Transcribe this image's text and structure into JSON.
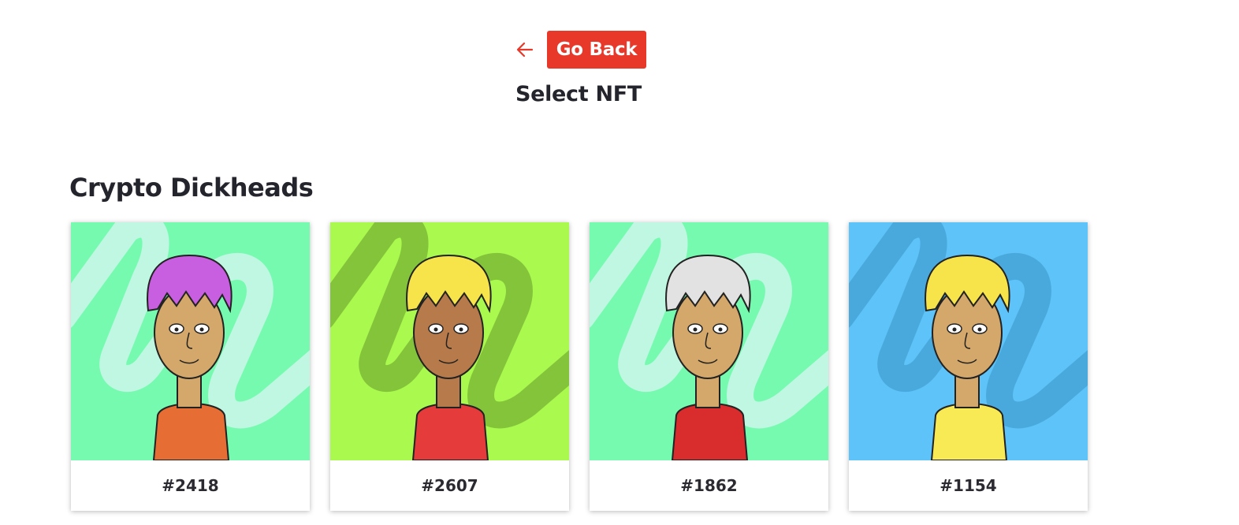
{
  "header": {
    "back_label": "Go Back",
    "page_title": "Select NFT",
    "accent_color": "#e8382a"
  },
  "collection": {
    "title": "Crypto Dickheads",
    "items": [
      {
        "token": "#2418",
        "bg": "#76fab0",
        "swirl": "#bff7e2",
        "hair": "#c75fe0",
        "skin": "#d4a76a",
        "shirt": "#e66d33"
      },
      {
        "token": "#2607",
        "bg": "#a9f94e",
        "swirl": "#84c43a",
        "hair": "#f7e44a",
        "skin": "#b77a4a",
        "shirt": "#e53b3b"
      },
      {
        "token": "#1862",
        "bg": "#76fab0",
        "swirl": "#bff7e2",
        "hair": "#e2e2e2",
        "skin": "#d4a76a",
        "shirt": "#d92c2c"
      },
      {
        "token": "#1154",
        "bg": "#5dc3f8",
        "swirl": "#4aa9dc",
        "hair": "#f7e44a",
        "skin": "#d4a76a",
        "shirt": "#f8ea55"
      }
    ]
  }
}
